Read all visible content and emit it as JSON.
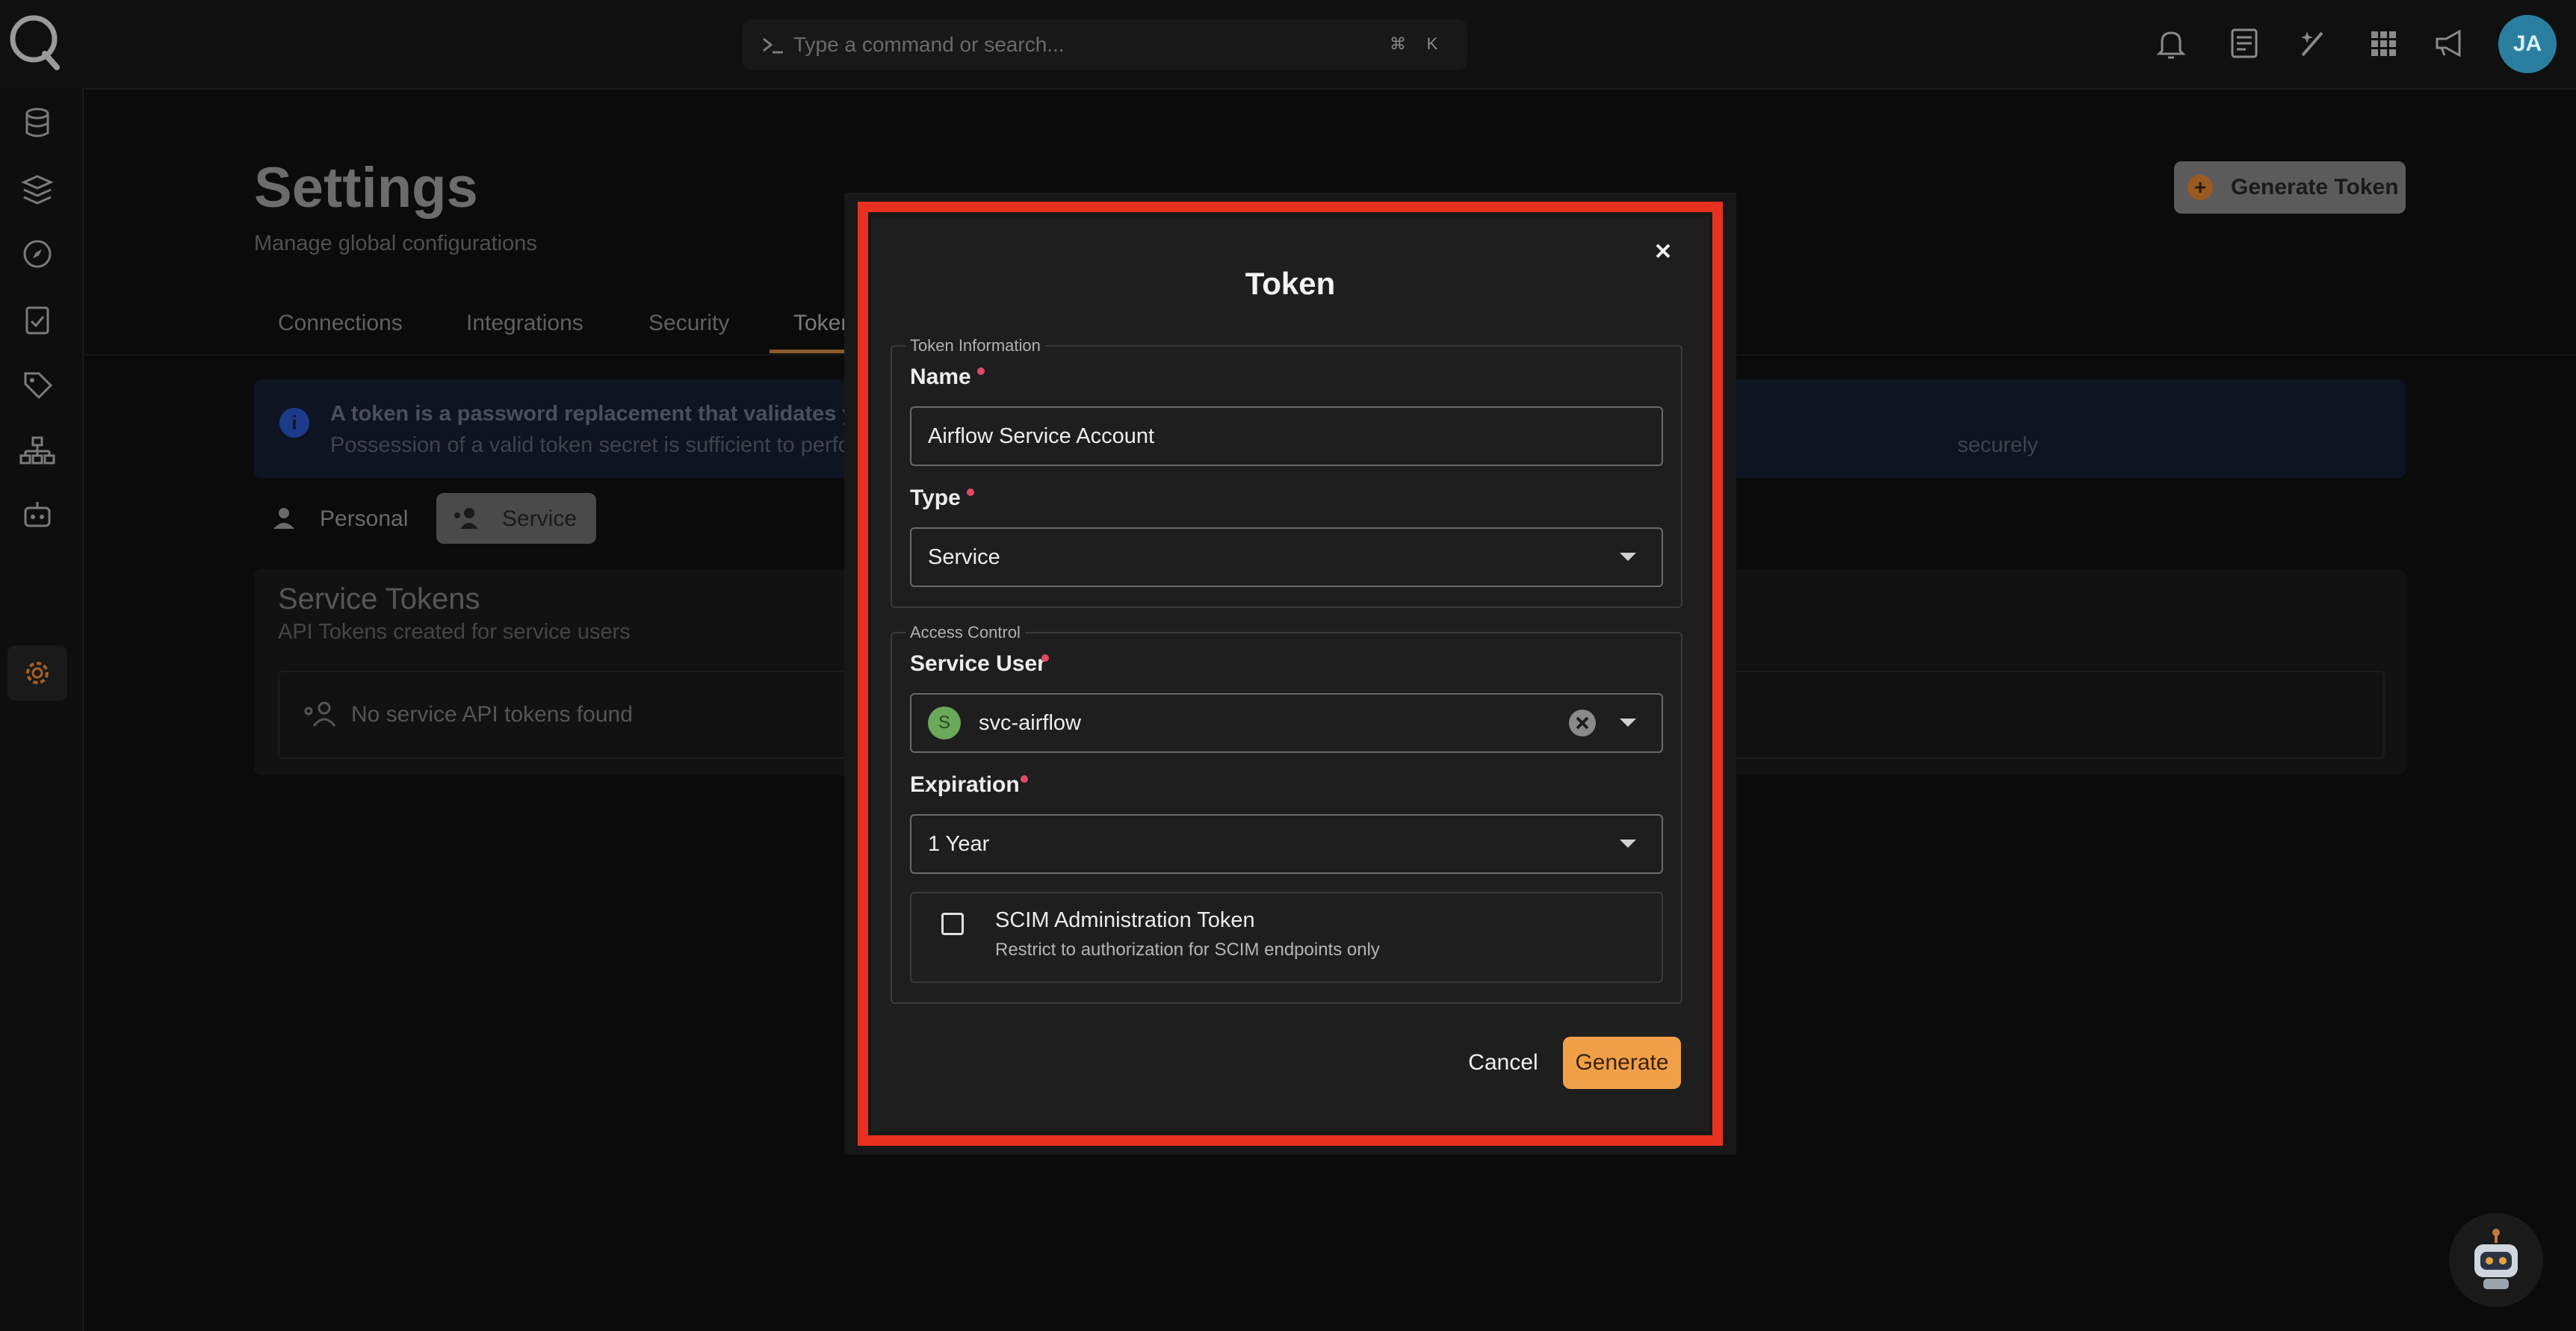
{
  "command_bar": {
    "placeholder": "Type a command or search...",
    "shortcut_mod": "⌘",
    "shortcut_key": "K"
  },
  "user": {
    "initials": "JA"
  },
  "page": {
    "title": "Settings",
    "subtitle": "Manage global configurations",
    "generate_token_label": "Generate Token"
  },
  "tabs": [
    {
      "label": "Connections"
    },
    {
      "label": "Integrations"
    },
    {
      "label": "Security"
    },
    {
      "label": "Tokens"
    }
  ],
  "info_banner": {
    "title": "A token is a password replacement that validates you",
    "body": "Possession of a valid token secret is sufficient to perfor",
    "tail": "securely"
  },
  "principal_types": {
    "personal": "Personal",
    "service": "Service"
  },
  "service_tokens": {
    "title": "Service Tokens",
    "subtitle": "API Tokens created for service users",
    "empty": "No service API tokens found"
  },
  "modal": {
    "title": "Token",
    "token_information": {
      "legend": "Token Information",
      "name_label": "Name",
      "name_value": "Airflow Service Account",
      "type_label": "Type",
      "type_value": "Service"
    },
    "access_control": {
      "legend": "Access Control",
      "service_user_label": "Service User",
      "service_user_initial": "S",
      "service_user_value": "svc-airflow",
      "expiration_label": "Expiration",
      "expiration_value": "1 Year",
      "scim_title": "SCIM Administration Token",
      "scim_desc": "Restrict to authorization for SCIM endpoints only",
      "scim_checked": false
    },
    "cancel_label": "Cancel",
    "generate_label": "Generate"
  },
  "colors": {
    "accent": "#f0a048",
    "required": "#e04a66",
    "highlight": "#e8311e"
  }
}
